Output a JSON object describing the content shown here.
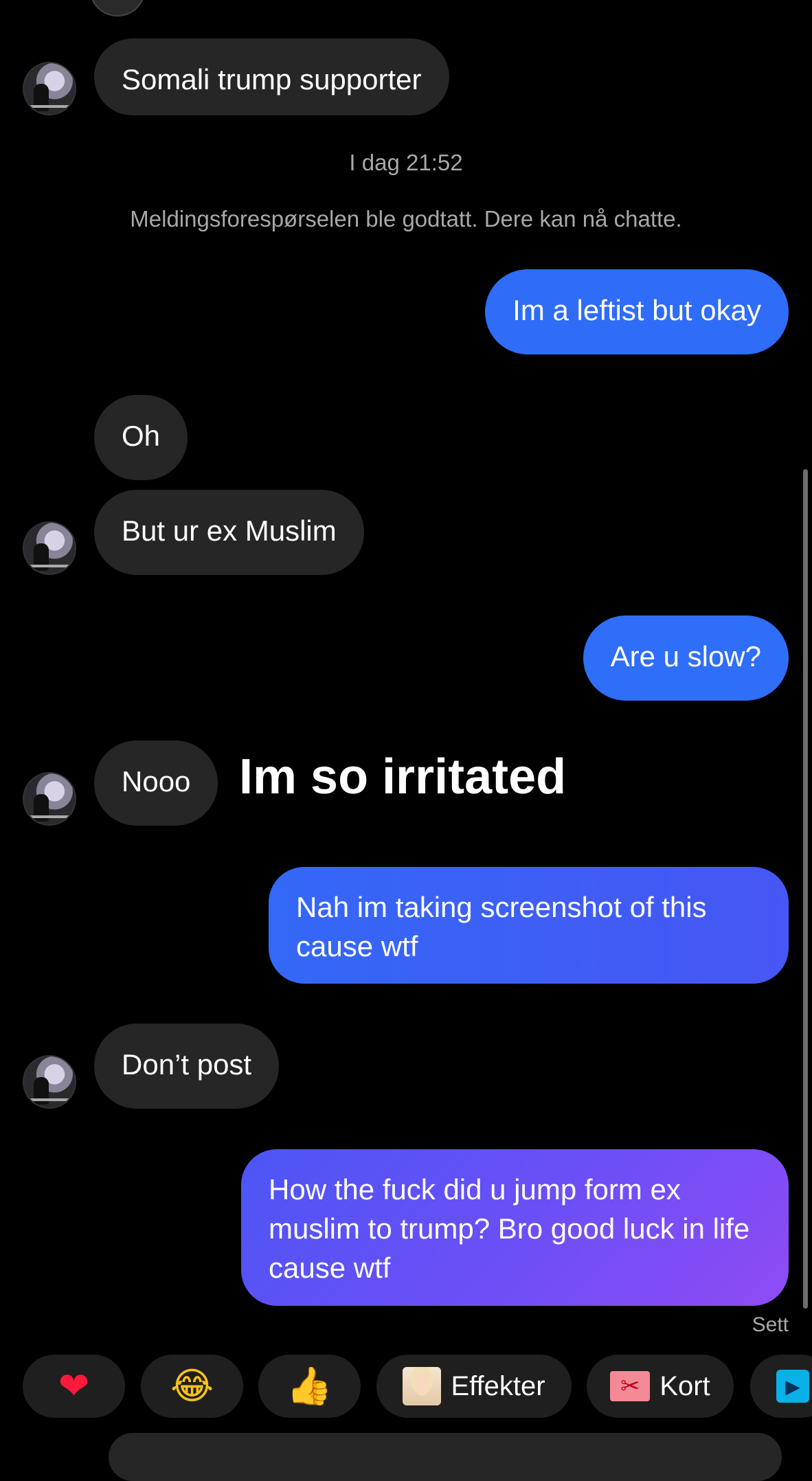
{
  "thread": {
    "timestamp": "I dag 21:52",
    "notice": "Meldingsforespørselen ble godtatt. Dere kan nå chatte.",
    "seen_label": "Sett"
  },
  "messages": [
    {
      "sender": "them",
      "text": "Somali trump supporter"
    },
    {
      "sender": "me",
      "text": "Im a leftist but okay"
    },
    {
      "sender": "them",
      "text": "Oh"
    },
    {
      "sender": "them",
      "text": "But ur ex Muslim"
    },
    {
      "sender": "me",
      "text": "Are u slow?"
    },
    {
      "sender": "them",
      "text": "Nooo"
    },
    {
      "sender": "me",
      "text": "Nah im taking screenshot of this cause wtf"
    },
    {
      "sender": "them",
      "text": "Don’t post"
    },
    {
      "sender": "me",
      "text": "How the fuck did u jump form ex muslim to trump? Bro good luck in life cause wtf"
    }
  ],
  "overlay_text": "Im so irritated",
  "quick_actions": {
    "heart": "❤",
    "laugh": "😂",
    "thumbs_up": "👍",
    "effects_label": "Effekter",
    "cards_label": "Kort"
  },
  "colors": {
    "incoming_bubble": "#262626",
    "outgoing_blue": "#3b6ff7",
    "outgoing_purple": "#8b4df5",
    "meta_text": "#a8a8a8"
  }
}
